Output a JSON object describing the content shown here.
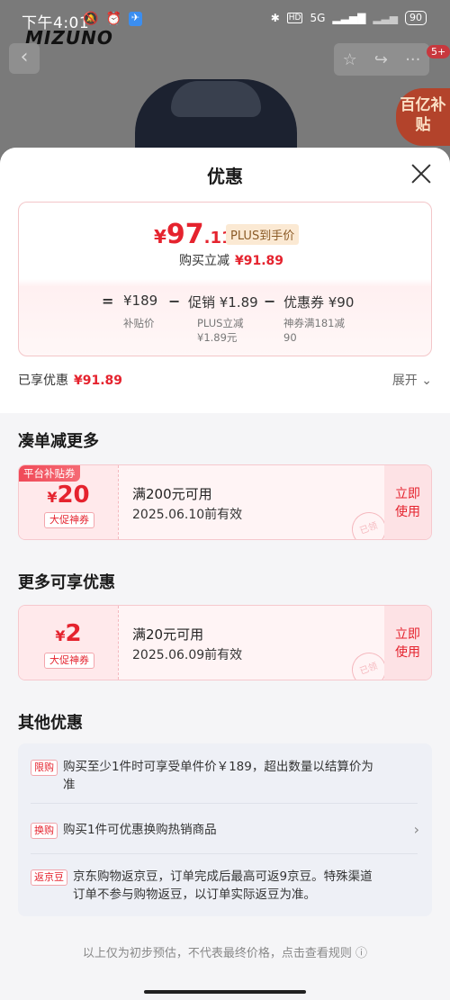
{
  "status_bar": {
    "time": "下午4:01",
    "network": "5G",
    "battery": "90"
  },
  "background": {
    "brand_logo": "MIZUNO",
    "subsidy_tag": "百亿补贴",
    "more_badge": "5+"
  },
  "sheet": {
    "title": "优惠",
    "price": {
      "currency": "¥",
      "integer": "97",
      "decimal": ".11",
      "plus_label": "PLUS到手价",
      "instant_label": "购买立减",
      "instant_value": "¥91.89"
    },
    "calc": {
      "eq": "=",
      "base_value": "¥189",
      "base_label": "补贴价",
      "minus1": "−",
      "promo_value": "促销 ¥1.89",
      "promo_label1": "PLUS立减",
      "promo_label2": "¥1.89元",
      "minus2": "−",
      "coupon_value": "优惠券 ¥90",
      "coupon_label1": "神券满181减",
      "coupon_label2": "90"
    },
    "enjoyed_label": "已享优惠",
    "enjoyed_value": "¥91.89",
    "expand_label": "展开",
    "section1_title": "凑单减更多",
    "coupon1": {
      "platform_tag": "平台补贴券",
      "currency": "¥",
      "amount": "20",
      "tag": "大促神券",
      "condition": "满200元可用",
      "validity": "2025.06.10前有效",
      "use_line1": "立即",
      "use_line2": "使用",
      "stamp": "已领"
    },
    "section2_title": "更多可享优惠",
    "coupon2": {
      "currency": "¥",
      "amount": "2",
      "tag": "大促神券",
      "condition": "满20元可用",
      "validity": "2025.06.09前有效",
      "use_line1": "立即",
      "use_line2": "使用",
      "stamp": "已领"
    },
    "section3_title": "其他优惠",
    "others": [
      {
        "tag": "限购",
        "line1": "购买至少1件时可享受单件价￥189，超出数量以结算价为",
        "line2": "准"
      },
      {
        "tag": "换购",
        "line1": "购买1件可优惠换购热销商品",
        "line2": ""
      },
      {
        "tag": "返京豆",
        "line1": "京东购物返京豆，订单完成后最高可返9京豆。特殊渠道",
        "line2": "订单不参与购物返豆，以订单实际返豆为准。"
      }
    ],
    "footer_note": "以上仅为初步预估，不代表最终价格，点击查看规则 ⓘ"
  }
}
